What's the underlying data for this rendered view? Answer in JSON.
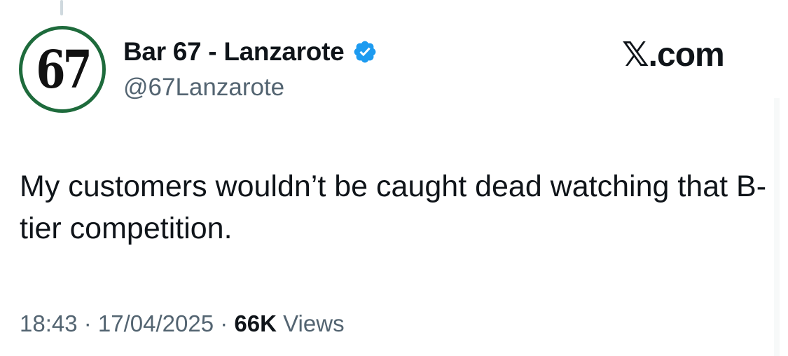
{
  "avatar": {
    "text": "67",
    "ring_color": "#1e6b3c"
  },
  "author": {
    "display_name": "Bar 67 - Lanzarote",
    "handle": "@67Lanzarote",
    "verified_icon": "verified-badge-icon",
    "verified_color": "#1d9bf0"
  },
  "brand": {
    "label": "𝕏.com"
  },
  "tweet": {
    "text": "My customers wouldn’t be caught dead watching that B-tier competition."
  },
  "meta": {
    "time": "18:43",
    "separator": " · ",
    "date": "17/04/2025",
    "views_count": "66K",
    "views_label": " Views"
  }
}
